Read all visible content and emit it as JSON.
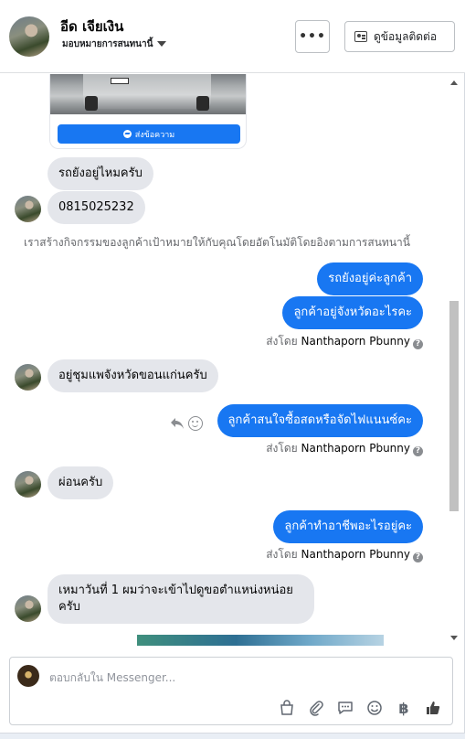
{
  "header": {
    "contact_name": "อีด เจียเงิน",
    "contact_subtitle": "มอบหมายการสนทนานี้",
    "more_label": "•••",
    "view_contact_label": "ดูข้อมูลติดต่อ"
  },
  "card": {
    "button_label": "ส่งข้อความ"
  },
  "messages": [
    {
      "from": "contact",
      "text": "รถยังอยู่ไหมครับ"
    },
    {
      "from": "contact",
      "text": "0815025232"
    },
    {
      "from": "system",
      "text": "เราสร้างกิจกรรมของลูกค้าเป้าหมายให้กับคุณโดยอัตโนมัติโดยอิงตามการสนทนานี้"
    },
    {
      "from": "page",
      "text": "รถยังอยู่ค่ะลูกค้า"
    },
    {
      "from": "page",
      "text": "ลูกค้าอยู่จังหวัดอะไรคะ"
    },
    {
      "from": "contact",
      "text": "อยู่ชุมแพจังหวัดขอนแก่นครับ"
    },
    {
      "from": "page",
      "text": "ลูกค้าสนใจซื้อสดหรือจัดไฟแนนซ์คะ"
    },
    {
      "from": "contact",
      "text": "ผ่อนครับ"
    },
    {
      "from": "page",
      "text": "ลูกค้าทำอาชีพอะไรอยู่คะ"
    },
    {
      "from": "contact",
      "text_line1": "เหมาวันที่ 1 ผมว่าจะเข้าไปดูขอตำแหน่งหน่อย",
      "text_line2": "ครับ"
    }
  ],
  "sent_by": {
    "prefix": "ส่งโดย",
    "name": "Nanthaporn Pbunny",
    "info": "?"
  },
  "composer": {
    "placeholder": "ตอบกลับใน Messenger...",
    "baht_symbol": "฿"
  },
  "colors": {
    "accent": "#1877f2",
    "incoming_bubble": "#e4e6eb"
  }
}
